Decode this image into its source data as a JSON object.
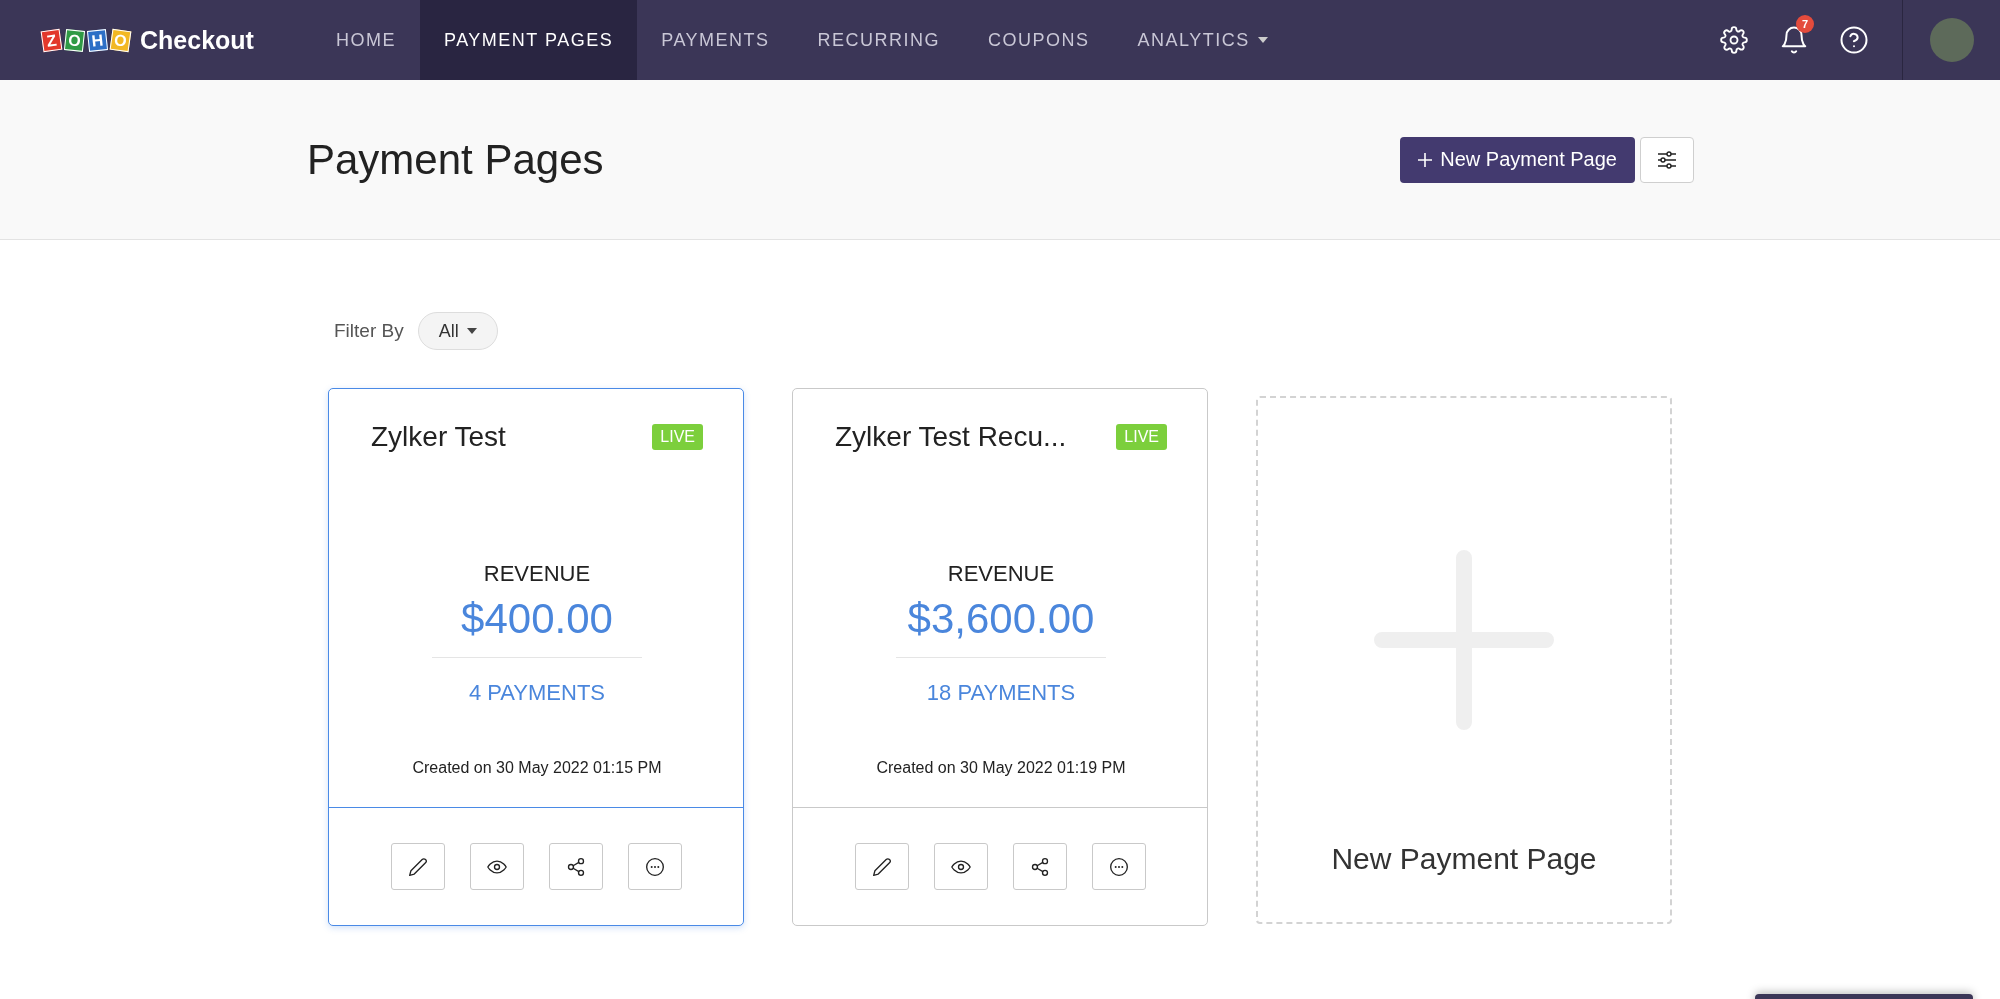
{
  "logo": {
    "letters": [
      "Z",
      "O",
      "H",
      "O"
    ],
    "product": "Checkout"
  },
  "nav": [
    {
      "label": "HOME",
      "selected": false,
      "dropdown": false
    },
    {
      "label": "PAYMENT PAGES",
      "selected": true,
      "dropdown": false
    },
    {
      "label": "PAYMENTS",
      "selected": false,
      "dropdown": false
    },
    {
      "label": "RECURRING",
      "selected": false,
      "dropdown": false
    },
    {
      "label": "COUPONS",
      "selected": false,
      "dropdown": false
    },
    {
      "label": "ANALYTICS",
      "selected": false,
      "dropdown": true
    }
  ],
  "notifications": {
    "count": "7"
  },
  "header": {
    "title": "Payment Pages",
    "new_button": "New Payment Page"
  },
  "filter": {
    "label": "Filter By",
    "value": "All"
  },
  "cards": [
    {
      "title": "Zylker Test",
      "status": "LIVE",
      "revenue_label": "REVENUE",
      "revenue": "$400.00",
      "payments": "4 PAYMENTS",
      "created": "Created on 30 May 2022 01:15 PM",
      "selected": true
    },
    {
      "title": "Zylker Test Recu...",
      "status": "LIVE",
      "revenue_label": "REVENUE",
      "revenue": "$3,600.00",
      "payments": "18 PAYMENTS",
      "created": "Created on 30 May 2022 01:19 PM",
      "selected": false
    }
  ],
  "add_card": {
    "label": "New Payment Page"
  }
}
